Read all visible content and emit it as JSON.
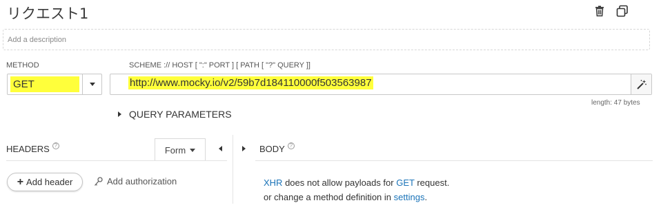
{
  "request": {
    "title": "リクエスト1",
    "description_placeholder": "Add a description"
  },
  "icons": {
    "delete": "trash-icon",
    "duplicate": "copy-icon",
    "wand": "magic-wand-icon",
    "auth": "key-icon"
  },
  "method": {
    "label": "METHOD",
    "value": "GET"
  },
  "url": {
    "label": "SCHEME :// HOST [ \":\" PORT ] [ PATH [ \"?\" QUERY ]]",
    "value": "http://www.mocky.io/v2/59b7d184110000f503563987",
    "length_text": "length: 47 bytes"
  },
  "query_parameters": {
    "label": "QUERY PARAMETERS"
  },
  "headers": {
    "title": "HEADERS",
    "help": "?",
    "editor_mode": "Form",
    "add_header_label": "Add header",
    "add_auth_label": "Add authorization"
  },
  "body": {
    "title": "BODY",
    "help": "?",
    "msg_xhr": "XHR",
    "msg_part1": " does not allow payloads for ",
    "msg_get": "GET",
    "msg_part2": " request.",
    "msg_part3": "or change a method definition in ",
    "msg_settings": "settings",
    "msg_end": "."
  },
  "colors": {
    "highlight": "#ffff3b",
    "link": "#1a73b8"
  }
}
